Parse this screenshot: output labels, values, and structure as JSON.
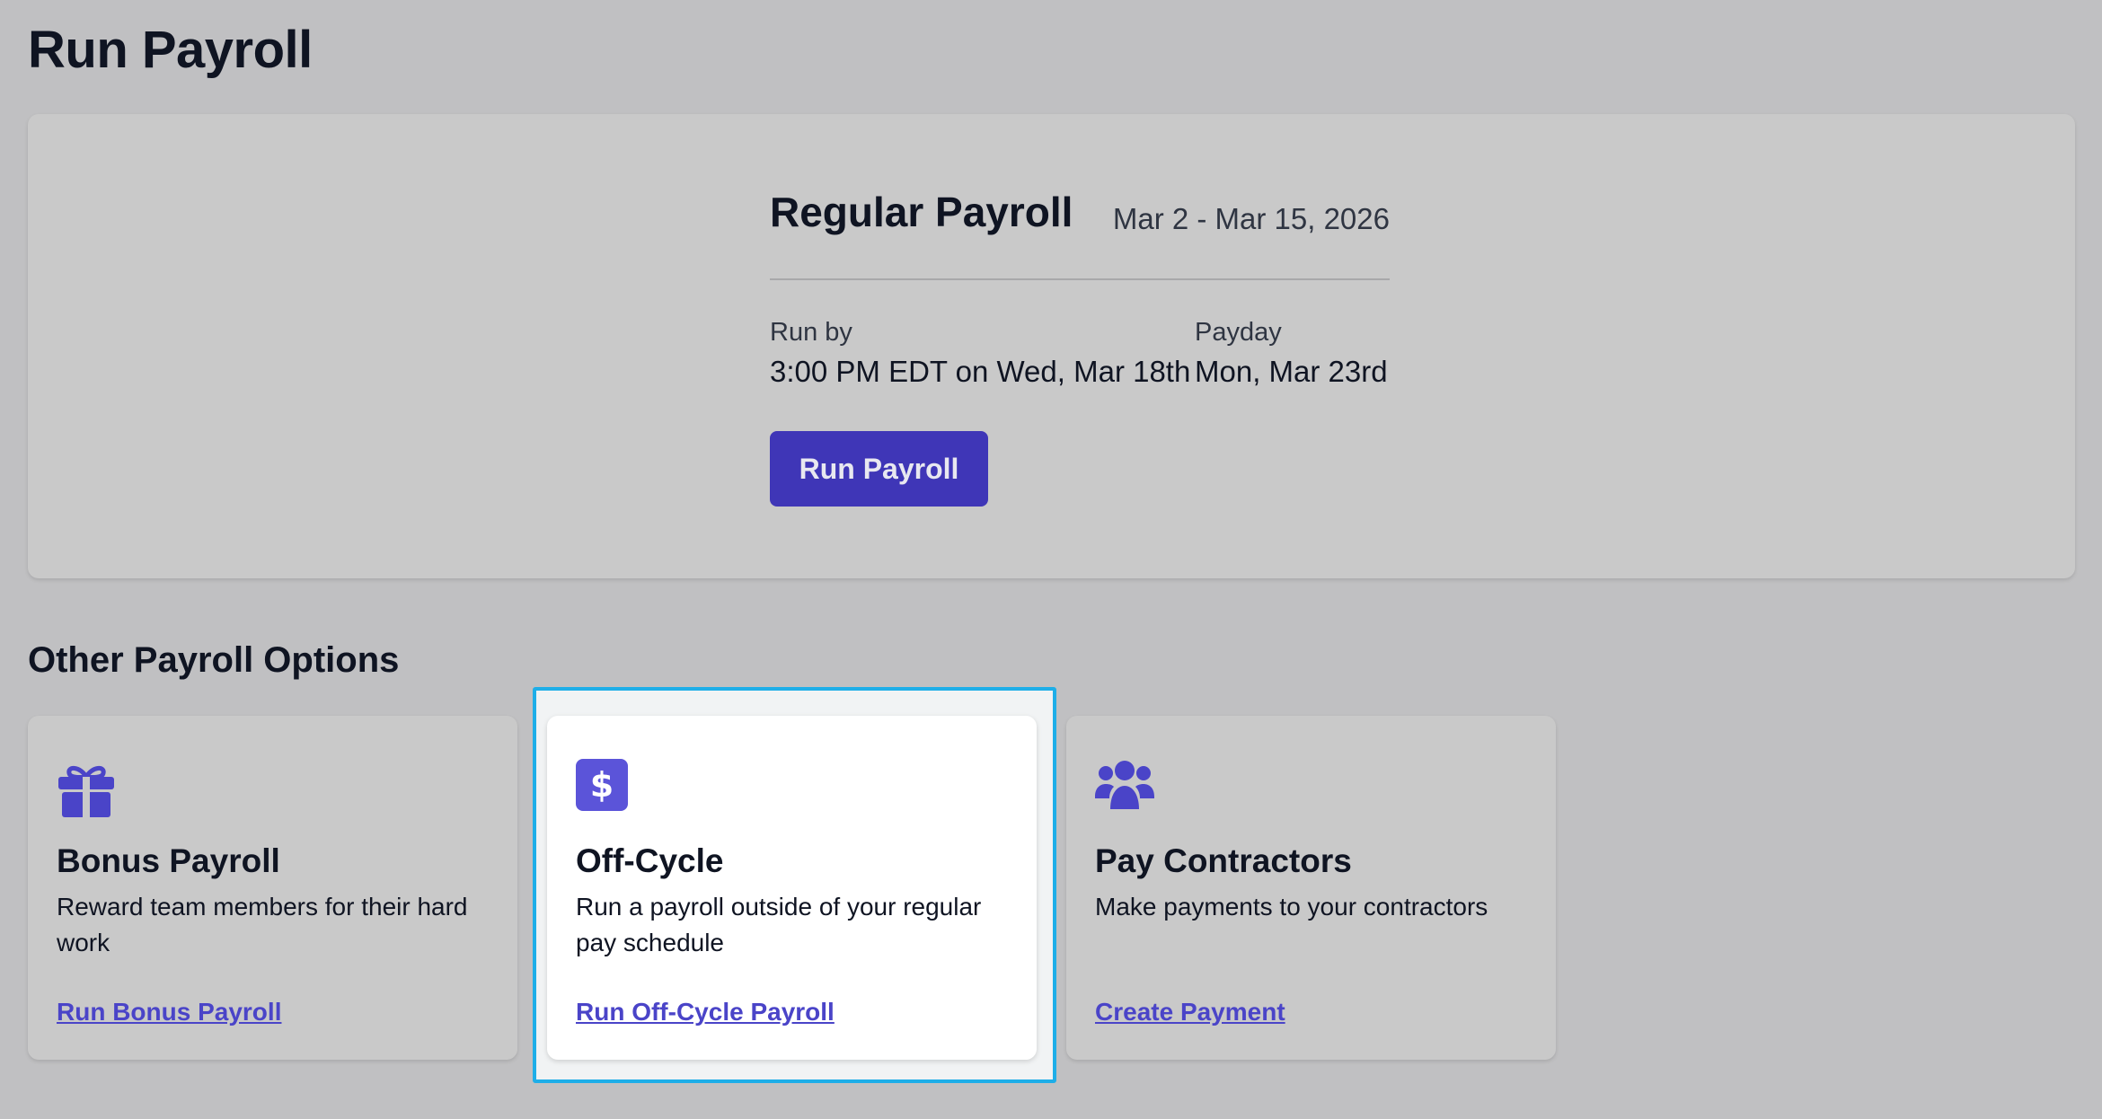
{
  "page": {
    "title": "Run Payroll"
  },
  "regular": {
    "title": "Regular Payroll",
    "dates": "Mar 2 - Mar 15, 2026",
    "run_by_label": "Run by",
    "run_by_value": "3:00 PM EDT on Wed, Mar 18th",
    "payday_label": "Payday",
    "payday_value": "Mon, Mar 23rd",
    "button_label": "Run Payroll"
  },
  "other": {
    "section_title": "Other Payroll Options",
    "cards": [
      {
        "icon": "gift-icon",
        "title": "Bonus Payroll",
        "description": "Reward team members for their hard work",
        "link": "Run Bonus Payroll"
      },
      {
        "icon": "dollar-icon",
        "title": "Off-Cycle",
        "description": "Run a payroll outside of your regular pay schedule",
        "link": "Run Off-Cycle Payroll"
      },
      {
        "icon": "users-icon",
        "title": "Pay Contractors",
        "description": "Make payments to your contractors",
        "link": "Create Payment"
      }
    ]
  },
  "colors": {
    "accent": "#3f36b7",
    "icon": "#4a44c8",
    "link": "#4a44c8",
    "highlight": "#1eaee8"
  }
}
